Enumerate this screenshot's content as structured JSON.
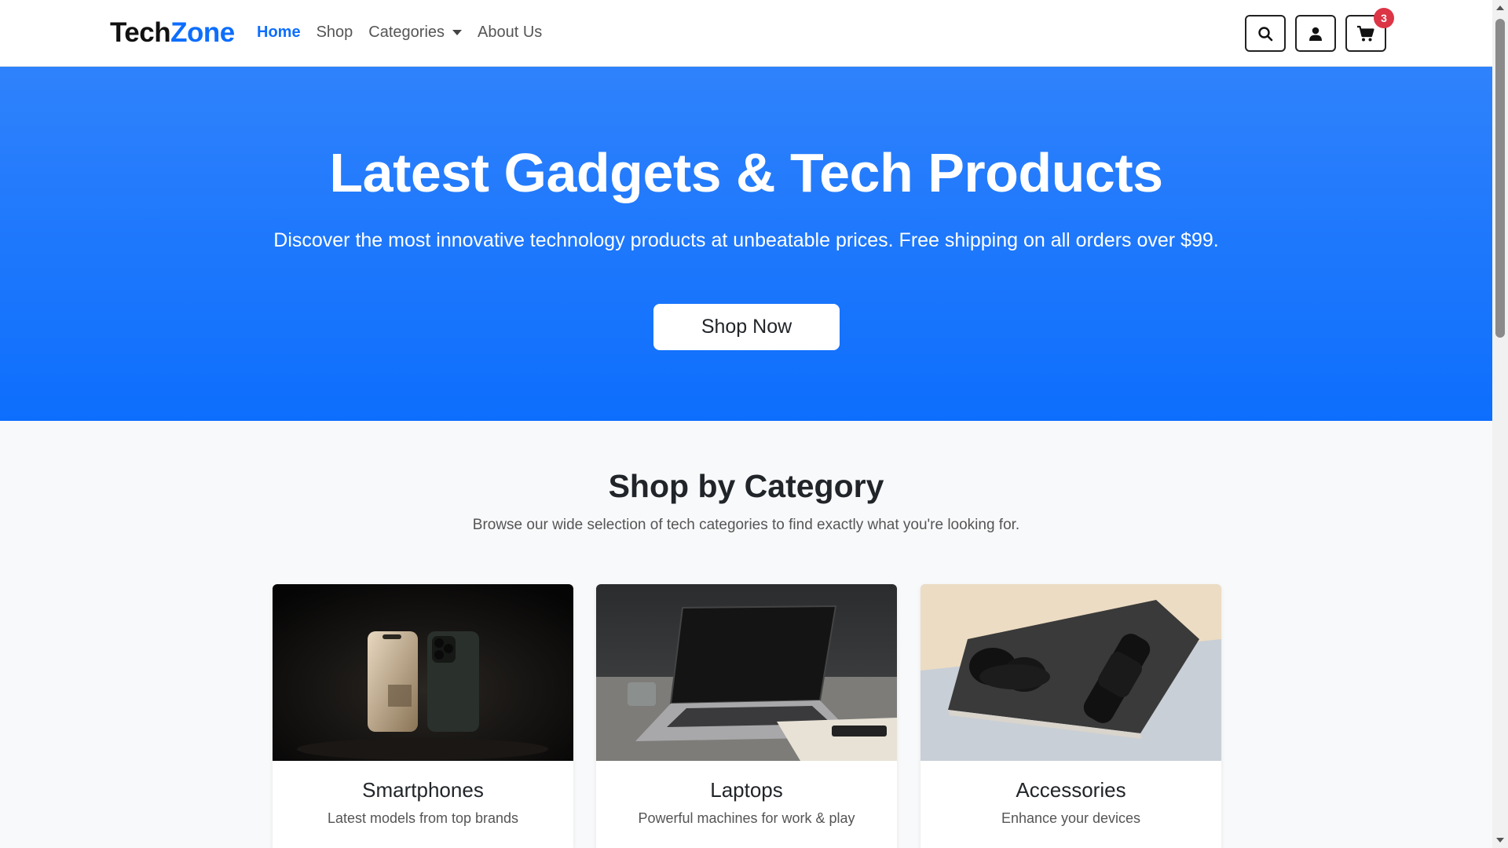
{
  "brand": {
    "part1": "Tech",
    "part2": "Zone"
  },
  "nav": {
    "home": "Home",
    "shop": "Shop",
    "categories": "Categories",
    "about": "About Us"
  },
  "cart": {
    "count": "3"
  },
  "icons": {
    "search": "search-icon",
    "user": "user-icon",
    "cart": "cart-icon"
  },
  "colors": {
    "primary": "#0d6efd",
    "badge": "#dc3545"
  },
  "hero": {
    "title": "Latest Gadgets & Tech Products",
    "subtitle": "Discover the most innovative technology products at unbeatable prices. Free shipping on all orders over $99.",
    "cta": "Shop Now"
  },
  "categories": {
    "title": "Shop by Category",
    "subtitle": "Browse our wide selection of tech categories to find exactly what you're looking for.",
    "items": [
      {
        "title": "Smartphones",
        "text": "Latest models from top brands"
      },
      {
        "title": "Laptops",
        "text": "Powerful machines for work & play"
      },
      {
        "title": "Accessories",
        "text": "Enhance your devices"
      }
    ]
  }
}
